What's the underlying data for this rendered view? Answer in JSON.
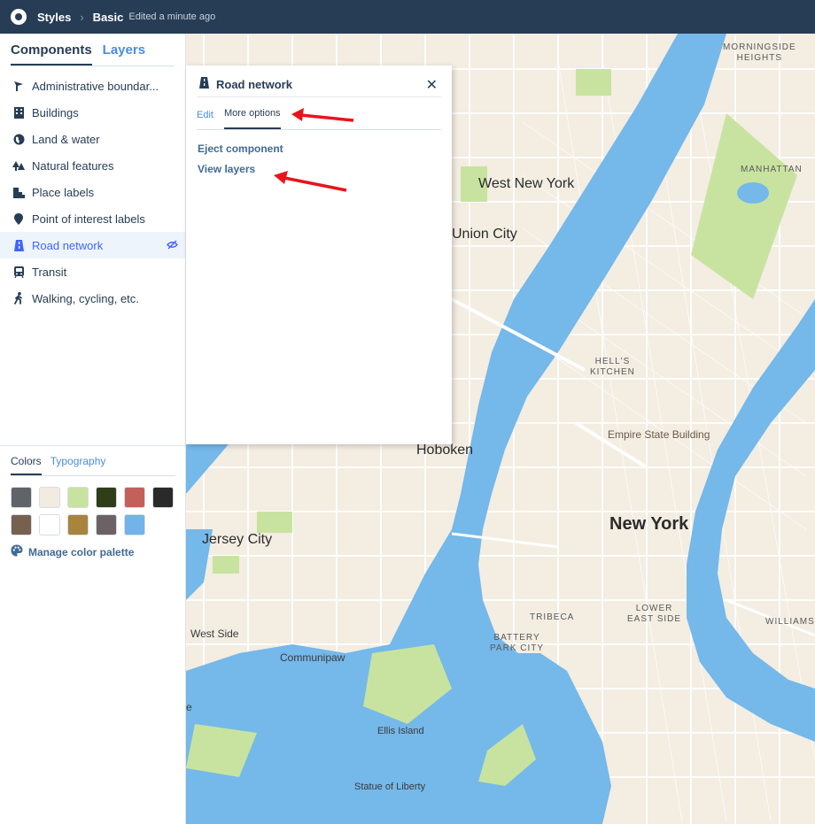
{
  "topbar": {
    "app": "Styles",
    "style_name": "Basic",
    "edited": "Edited a minute ago"
  },
  "sidebar": {
    "tabs": [
      "Components",
      "Layers"
    ],
    "items": [
      {
        "label": "Administrative boundar...",
        "icon": "flag-icon"
      },
      {
        "label": "Buildings",
        "icon": "building-icon"
      },
      {
        "label": "Land & water",
        "icon": "globe-icon"
      },
      {
        "label": "Natural features",
        "icon": "trees-icon"
      },
      {
        "label": "Place labels",
        "icon": "city-icon"
      },
      {
        "label": "Point of interest labels",
        "icon": "marker-icon"
      },
      {
        "label": "Road network",
        "icon": "road-icon",
        "active": true
      },
      {
        "label": "Transit",
        "icon": "train-icon"
      },
      {
        "label": "Walking, cycling, etc.",
        "icon": "pedestrian-icon"
      }
    ],
    "color_tabs": [
      "Colors",
      "Typography"
    ],
    "swatches": [
      "#606469",
      "#f2ebe1",
      "#c8e3a0",
      "#2f3d19",
      "#c4605a",
      "#2a2a2a",
      "#76614f",
      "#ffffff",
      "#a8843f",
      "#6c6266",
      "#72b3eb"
    ],
    "manage_label": "Manage color palette"
  },
  "popover": {
    "title": "Road network",
    "tabs": [
      "Edit",
      "More options"
    ],
    "links": [
      "Eject component",
      "View layers"
    ]
  },
  "map": {
    "labels": {
      "morningside": "MORNINGSIDE",
      "heights": "HEIGHTS",
      "manhattan": "MANHATTAN",
      "west_new_york": "West New York",
      "union_city": "Union City",
      "hells": "HELL'S",
      "kitchen": "KITCHEN",
      "empire": "Empire State Building",
      "hoboken": "Hoboken",
      "new_york": "New York",
      "jersey_city": "Jersey City",
      "tribeca": "TRIBECA",
      "lower": "LOWER",
      "east_side": "EAST SIDE",
      "williams": "WILLIAMS",
      "battery": "BATTERY",
      "park_city": "PARK CITY",
      "west_side": "West Side",
      "communipaw": "Communipaw",
      "ellis": "Ellis Island",
      "statue": "Statue of Liberty",
      "edge_e": "e"
    }
  },
  "colors": {
    "accent": "#4264fb",
    "topbar": "#273d56",
    "water": "#75b8ea",
    "land": "#f3ede2",
    "park": "#c8e3a0",
    "annotation": "#e8151b"
  }
}
